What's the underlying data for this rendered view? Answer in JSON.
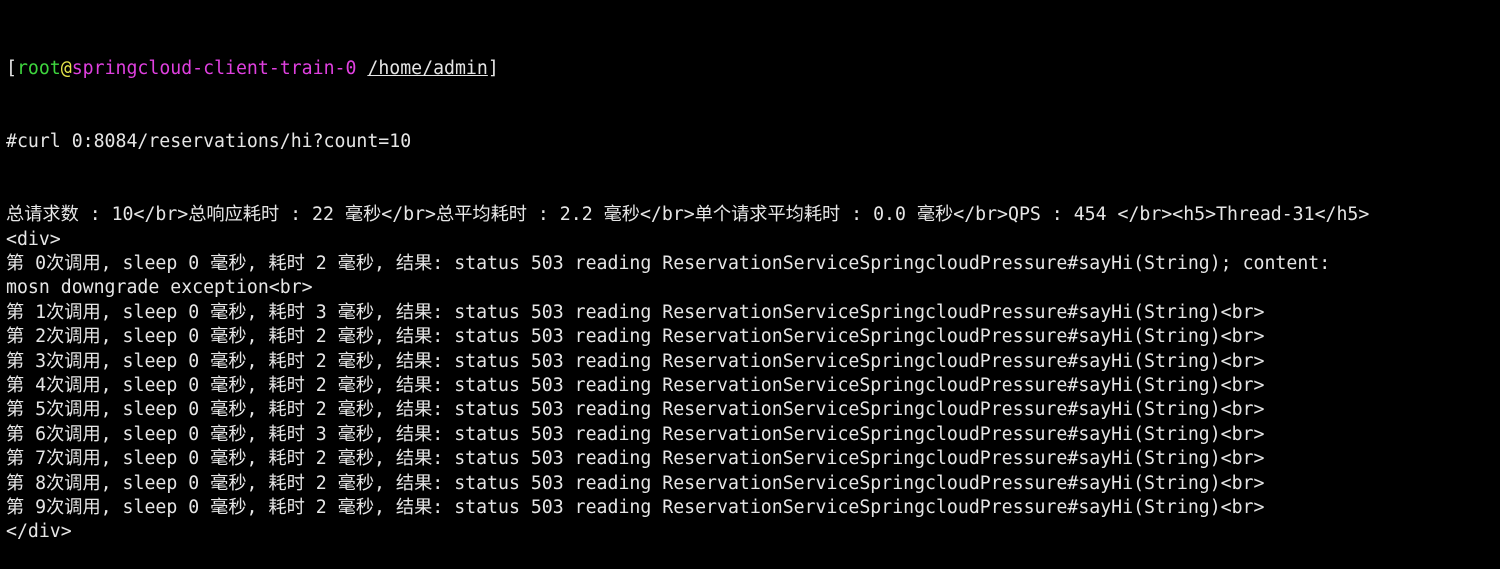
{
  "prompt": {
    "open_bracket": "[",
    "user": "root",
    "at": "@",
    "host": "springcloud-client-train-0",
    "path": "/home/admin",
    "close_bracket": "]",
    "colors": {
      "user": "#3ed63e",
      "at": "#e6e64a",
      "host": "#e040e0"
    }
  },
  "command": "#curl 0:8084/reservations/hi?count=10",
  "output": [
    "总请求数 : 10</br>总响应耗时 : 22 毫秒</br>总平均耗时 : 2.2 毫秒</br>单个请求平均耗时 : 0.0 毫秒</br>QPS : 454 </br><h5>Thread-31</h5>",
    "<div>",
    "第 0次调用, sleep 0 毫秒, 耗时 2 毫秒, 结果: status 503 reading ReservationServiceSpringcloudPressure#sayHi(String); content:",
    "mosn downgrade exception<br>",
    "第 1次调用, sleep 0 毫秒, 耗时 3 毫秒, 结果: status 503 reading ReservationServiceSpringcloudPressure#sayHi(String)<br>",
    "第 2次调用, sleep 0 毫秒, 耗时 2 毫秒, 结果: status 503 reading ReservationServiceSpringcloudPressure#sayHi(String)<br>",
    "第 3次调用, sleep 0 毫秒, 耗时 2 毫秒, 结果: status 503 reading ReservationServiceSpringcloudPressure#sayHi(String)<br>",
    "第 4次调用, sleep 0 毫秒, 耗时 2 毫秒, 结果: status 503 reading ReservationServiceSpringcloudPressure#sayHi(String)<br>",
    "第 5次调用, sleep 0 毫秒, 耗时 2 毫秒, 结果: status 503 reading ReservationServiceSpringcloudPressure#sayHi(String)<br>",
    "第 6次调用, sleep 0 毫秒, 耗时 3 毫秒, 结果: status 503 reading ReservationServiceSpringcloudPressure#sayHi(String)<br>",
    "第 7次调用, sleep 0 毫秒, 耗时 2 毫秒, 结果: status 503 reading ReservationServiceSpringcloudPressure#sayHi(String)<br>",
    "第 8次调用, sleep 0 毫秒, 耗时 2 毫秒, 结果: status 503 reading ReservationServiceSpringcloudPressure#sayHi(String)<br>",
    "第 9次调用, sleep 0 毫秒, 耗时 2 毫秒, 结果: status 503 reading ReservationServiceSpringcloudPressure#sayHi(String)<br>",
    "</div>"
  ]
}
